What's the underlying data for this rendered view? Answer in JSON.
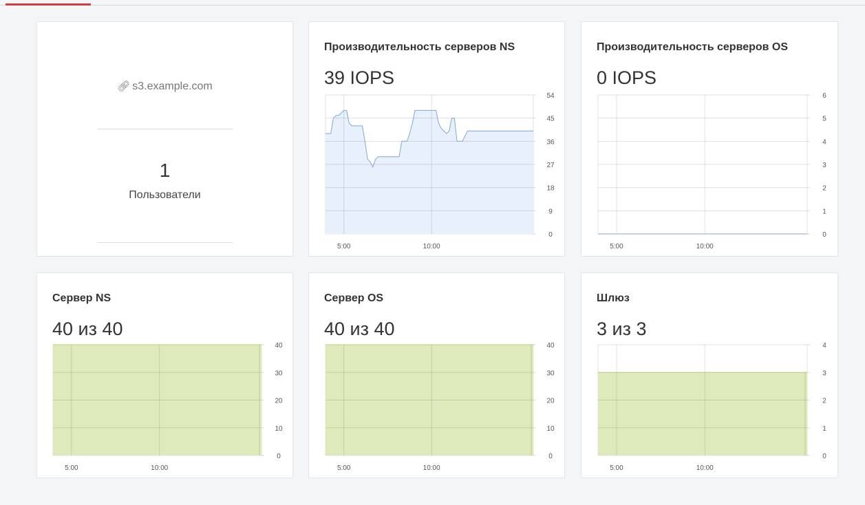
{
  "summary": {
    "host": "s3.example.com",
    "host_icon": "link-icon",
    "user_count": "1",
    "user_label": "Пользователи"
  },
  "cards": {
    "ns_perf": {
      "title": "Производительность серверов NS",
      "value": "39 IOPS"
    },
    "os_perf": {
      "title": "Производительность серверов OS",
      "value": "0 IOPS"
    },
    "ns_server": {
      "title": "Сервер NS",
      "value": "40 из 40"
    },
    "os_server": {
      "title": "Сервер OS",
      "value": "40 из 40"
    },
    "gateway": {
      "title": "Шлюз",
      "value": "3 из 3"
    }
  },
  "colors": {
    "accent": "#d83a3a",
    "line_stroke": "#7fa7d6",
    "line_fill": "#e8f0fc",
    "status_fill": "#dfeabc",
    "status_stroke": "#b9cf82"
  },
  "chart_data": [
    {
      "type": "area",
      "id": "ns_perf",
      "x": [
        3.95,
        4.1,
        4.25,
        4.4,
        4.55,
        4.7,
        4.85,
        5.0,
        5.15,
        5.3,
        5.45,
        5.6,
        5.75,
        5.9,
        6.05,
        6.2,
        6.35,
        6.5,
        6.65,
        6.8,
        6.95,
        7.1,
        7.25,
        7.4,
        7.55,
        7.7,
        7.85,
        8.0,
        8.15,
        8.3,
        8.45,
        8.6,
        8.75,
        8.9,
        9.05,
        9.2,
        9.35,
        9.5,
        9.65,
        9.8,
        9.95,
        10.1,
        10.25,
        10.4,
        10.55,
        10.7,
        10.85,
        11.0,
        11.15,
        11.3,
        11.45,
        11.6,
        11.75,
        11.9,
        12.05,
        12.2,
        12.35,
        12.5,
        12.65,
        12.8,
        12.95,
        13.1,
        13.25,
        13.4,
        13.55,
        13.7,
        13.85,
        14.0,
        14.15,
        14.3,
        14.45,
        14.6,
        14.75,
        14.9,
        15.05,
        15.2,
        15.35,
        15.5,
        15.65,
        15.8
      ],
      "y": [
        39,
        39,
        39,
        45,
        46,
        46,
        47,
        48,
        48,
        43,
        42,
        42,
        42,
        42,
        42,
        36,
        29,
        28,
        26,
        29,
        30,
        30,
        30,
        30,
        30,
        30,
        30,
        30,
        30,
        36,
        36,
        36,
        39,
        43,
        48,
        48,
        48,
        48,
        48,
        48,
        48,
        48,
        48,
        43,
        41,
        40,
        39,
        40,
        45,
        45,
        36,
        36,
        36,
        38,
        40,
        40,
        40,
        40,
        40,
        40,
        40,
        40,
        40,
        40,
        40,
        40,
        40,
        40,
        40,
        40,
        40,
        40,
        40,
        40,
        40,
        40,
        40,
        40,
        40,
        40
      ],
      "xticks": [
        "5:00",
        "10:00"
      ],
      "yticks": [
        "0",
        "9",
        "18",
        "27",
        "36",
        "45",
        "54"
      ],
      "ylim": [
        0,
        54
      ],
      "grid": true
    },
    {
      "type": "area",
      "id": "os_perf",
      "x": [
        3.95,
        15.8
      ],
      "y": [
        0,
        0
      ],
      "xticks": [
        "5:00",
        "10:00"
      ],
      "yticks": [
        "0",
        "1",
        "2",
        "3",
        "4",
        "5",
        "6"
      ],
      "ylim": [
        0,
        6
      ],
      "grid": true
    },
    {
      "type": "area",
      "id": "ns_server",
      "x": [
        3.95,
        15.8
      ],
      "y": [
        40,
        40
      ],
      "xticks": [
        "5:00",
        "10:00"
      ],
      "yticks": [
        "0",
        "10",
        "20",
        "30",
        "40"
      ],
      "ylim": [
        0,
        40
      ],
      "grid": true
    },
    {
      "type": "area",
      "id": "os_server",
      "x": [
        3.95,
        15.8
      ],
      "y": [
        40,
        40
      ],
      "xticks": [
        "5:00",
        "10:00"
      ],
      "yticks": [
        "0",
        "10",
        "20",
        "30",
        "40"
      ],
      "ylim": [
        0,
        40
      ],
      "grid": true
    },
    {
      "type": "area",
      "id": "gateway",
      "x": [
        3.95,
        15.8
      ],
      "y": [
        3,
        3
      ],
      "xticks": [
        "5:00",
        "10:00"
      ],
      "yticks": [
        "0",
        "1",
        "2",
        "3",
        "4"
      ],
      "ylim": [
        0,
        4
      ],
      "grid": true
    }
  ]
}
